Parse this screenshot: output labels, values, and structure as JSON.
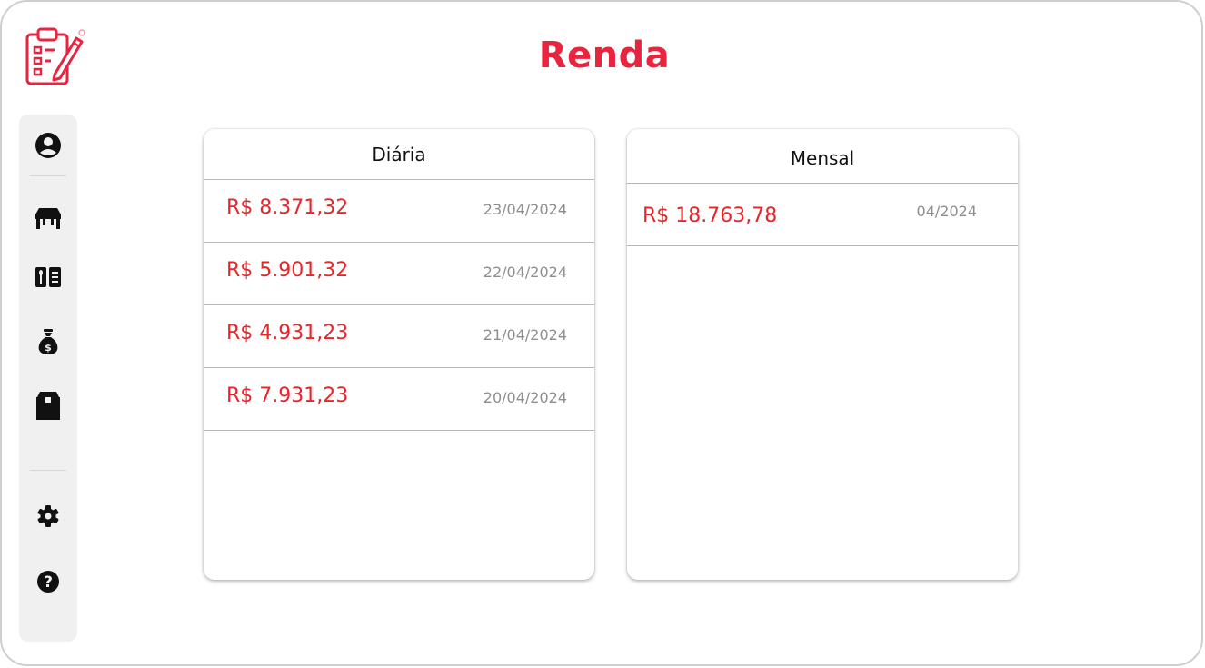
{
  "app": {
    "title": "Renda"
  },
  "sidebar": {
    "items": [
      {
        "name": "profile",
        "icon": "user-circle-icon"
      },
      {
        "name": "tables",
        "icon": "table-icon"
      },
      {
        "name": "menu",
        "icon": "menu-book-icon"
      },
      {
        "name": "income",
        "icon": "money-bag-icon"
      },
      {
        "name": "inventory",
        "icon": "box-icon"
      }
    ],
    "bottom_items": [
      {
        "name": "settings",
        "icon": "gear-icon"
      },
      {
        "name": "help",
        "icon": "help-circle-icon"
      }
    ]
  },
  "daily": {
    "title": "Diária",
    "rows": [
      {
        "amount": "R$ 8.371,32",
        "date": "23/04/2024"
      },
      {
        "amount": "R$ 5.901,32",
        "date": "22/04/2024"
      },
      {
        "amount": "R$ 4.931,23",
        "date": "21/04/2024"
      },
      {
        "amount": "R$ 7.931,23",
        "date": "20/04/2024"
      }
    ]
  },
  "monthly": {
    "title": "Mensal",
    "rows": [
      {
        "amount": "R$ 18.763,78",
        "date": "04/2024"
      }
    ]
  },
  "colors": {
    "accent": "#e9243f",
    "amount": "#e8262a",
    "date": "#8e8e8e",
    "sidebar_bg": "#f0f0f0",
    "icon": "#111111"
  }
}
